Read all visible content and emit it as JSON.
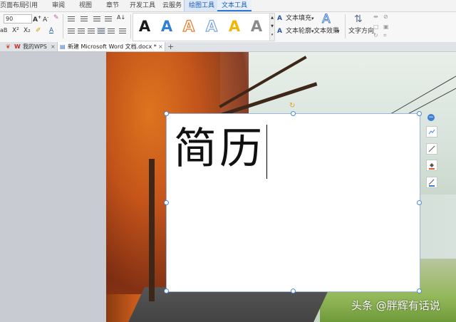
{
  "menu": {
    "items": [
      "页面布局",
      "引用",
      "审阅",
      "视图",
      "章节",
      "开发工具",
      "云服务",
      "绘图工具",
      "文本工具"
    ]
  },
  "ribbon": {
    "font_size": "90",
    "wordart_styles": [
      "A",
      "A",
      "A",
      "A",
      "A",
      "A"
    ],
    "text_fill": "文本填充",
    "text_outline": "文本轮廓",
    "text_effects": "文本效果",
    "text_direction": "文字方向"
  },
  "tabs": {
    "home": "我的WPS",
    "doc": "新建 Microsoft Word 文档.docx *",
    "close": "×",
    "add": "+"
  },
  "document": {
    "title": "简历"
  },
  "watermark": "头条 @胖辉有话说",
  "colors": {
    "accent": "#2b79d6",
    "wordart_black": "#1a1a1a",
    "wordart_blue": "#2f7fd3",
    "wordart_orange": "#e87a2a",
    "wordart_outline": "#7aa6d8",
    "wordart_yellow": "#f2b705",
    "wordart_gray": "#8a8a8a"
  }
}
